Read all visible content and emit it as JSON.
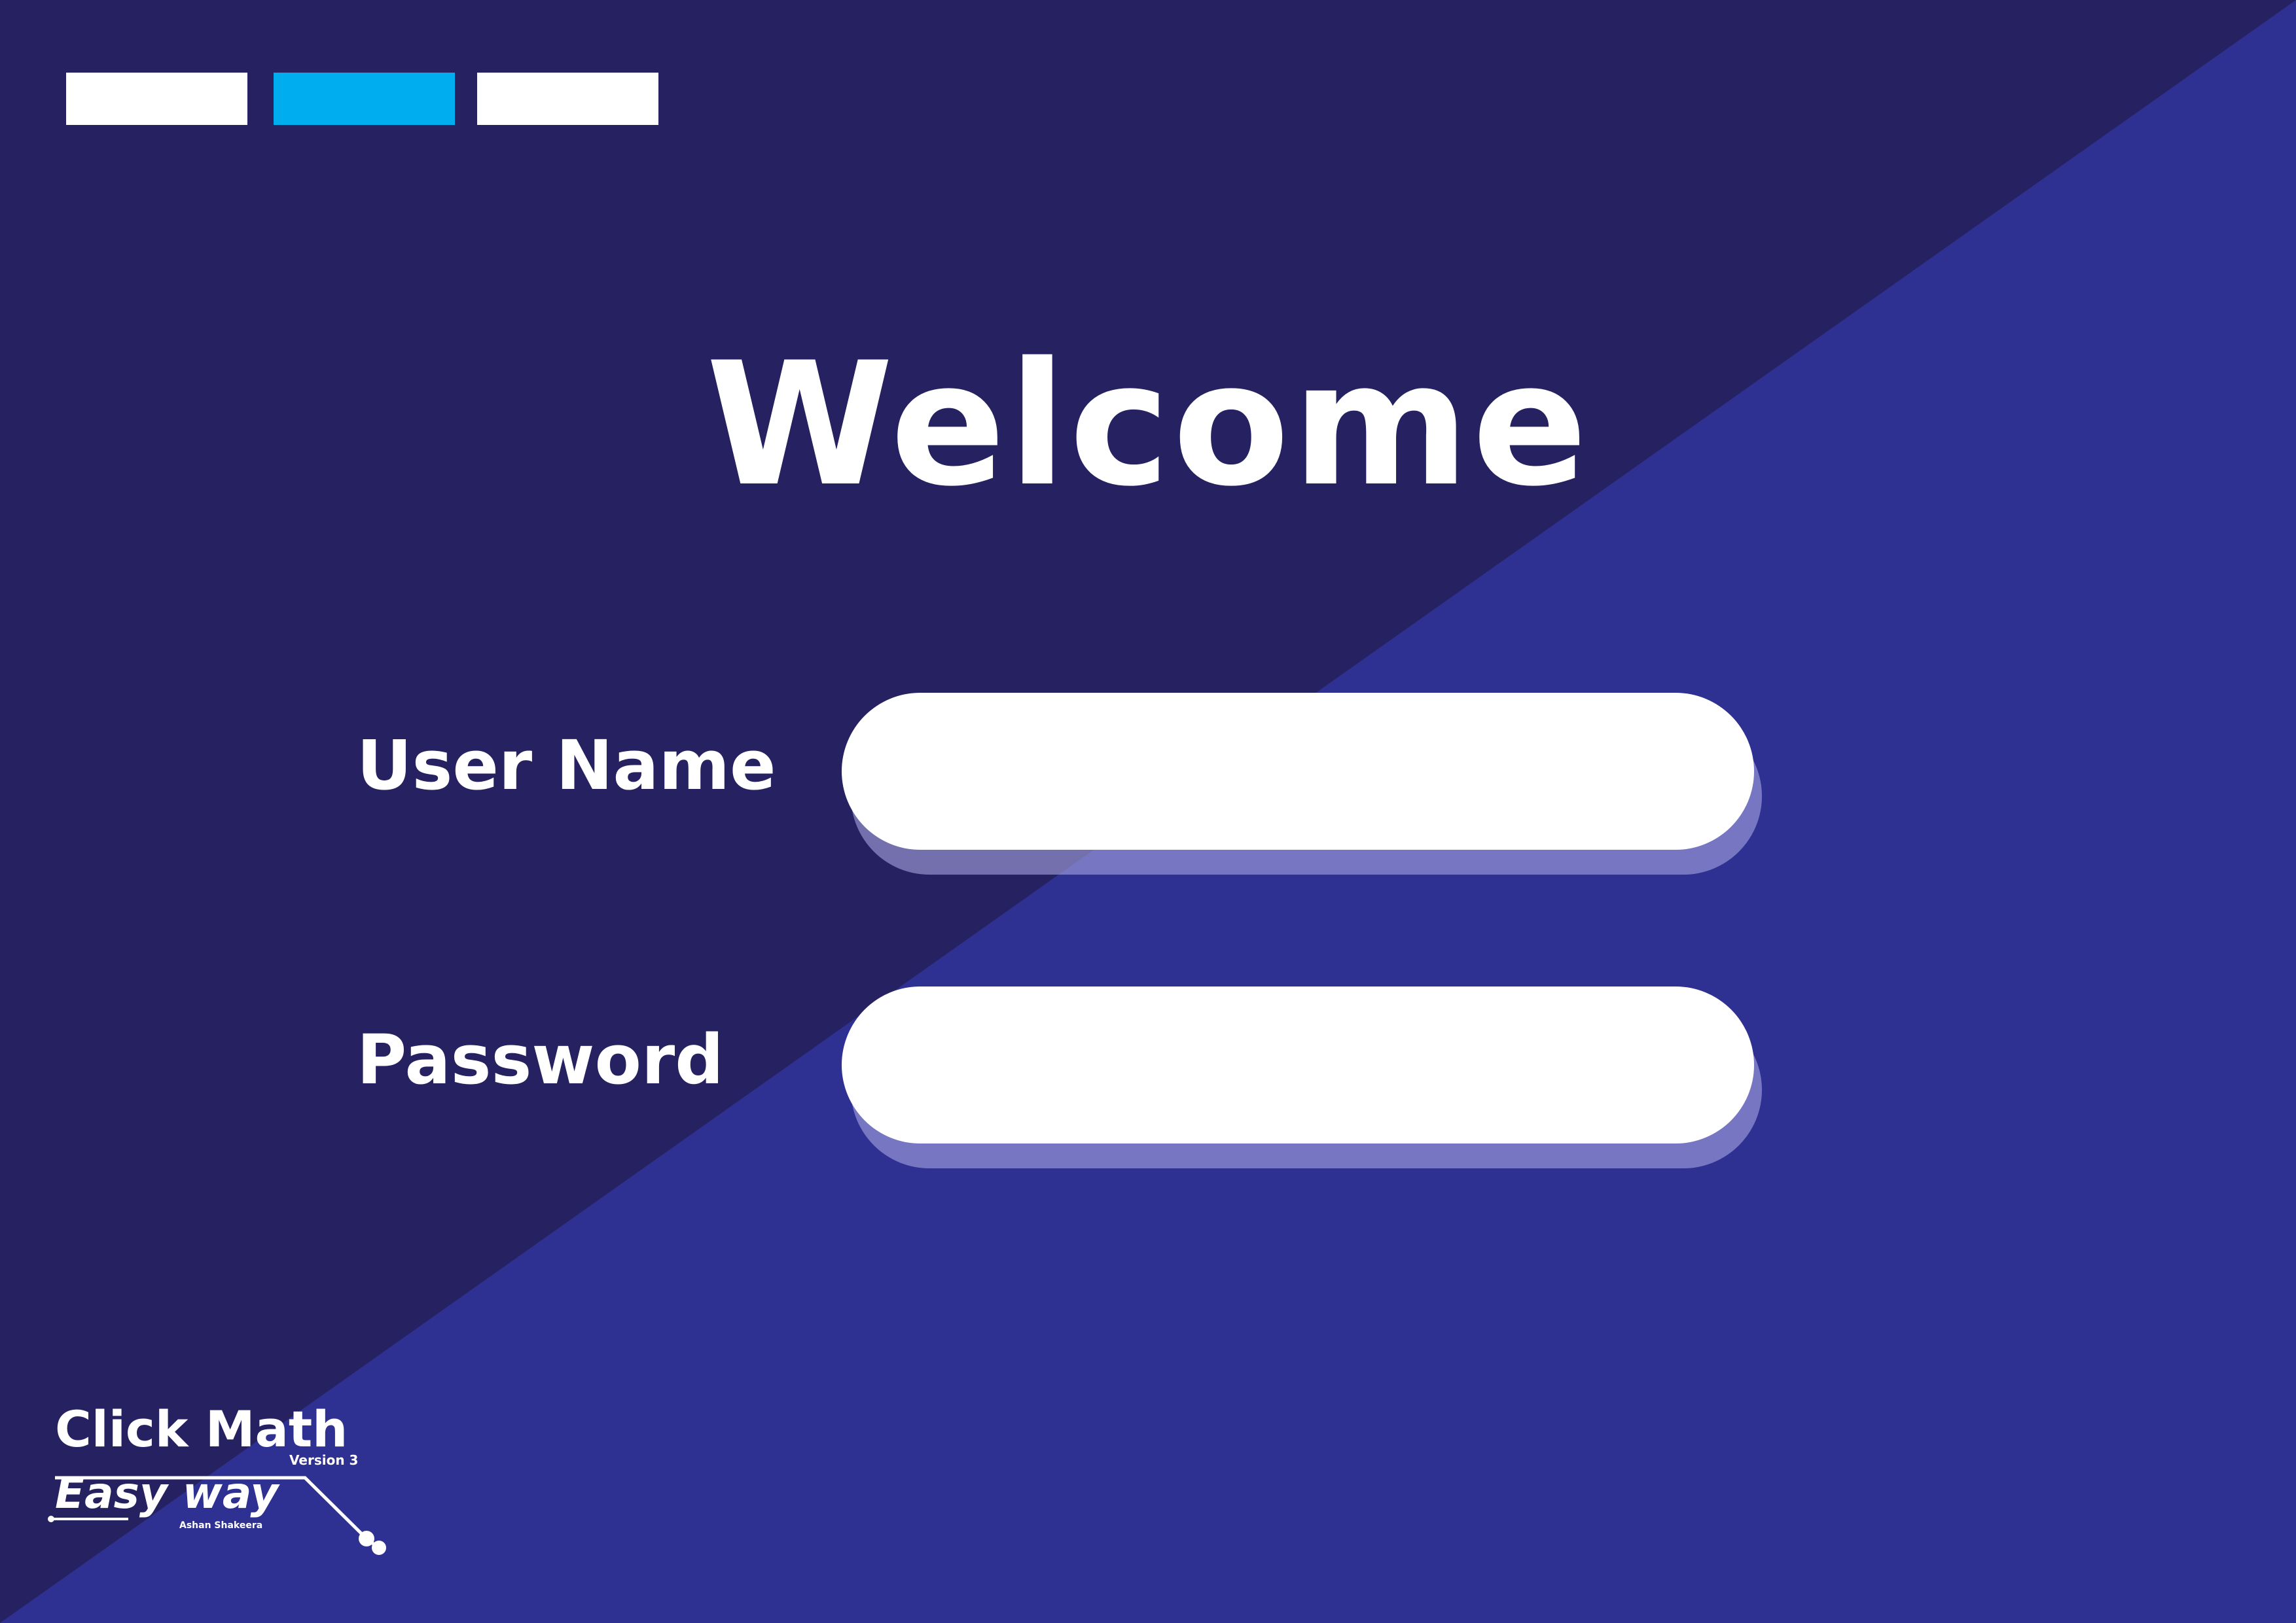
{
  "screen": {
    "title": "Welcome"
  },
  "colors": {
    "background_dark": "#262262",
    "background_light": "#2e3192",
    "step_inactive": "#ffffff",
    "step_active": "#00aeef",
    "text": "#ffffff",
    "field_background": "#ffffff",
    "field_shadow": "#b4afeb"
  },
  "progress": {
    "total_steps": 3,
    "active_step": 2
  },
  "form": {
    "username_label": "User Name",
    "username_value": "",
    "password_label": "Password",
    "password_value": ""
  },
  "logo": {
    "title": "Click Math",
    "version": "Version 3",
    "subtitle": "Easy way",
    "author": "Ashan Shakeera"
  },
  "icons": {
    "logo_circuit": "circuit-trace-icon"
  }
}
